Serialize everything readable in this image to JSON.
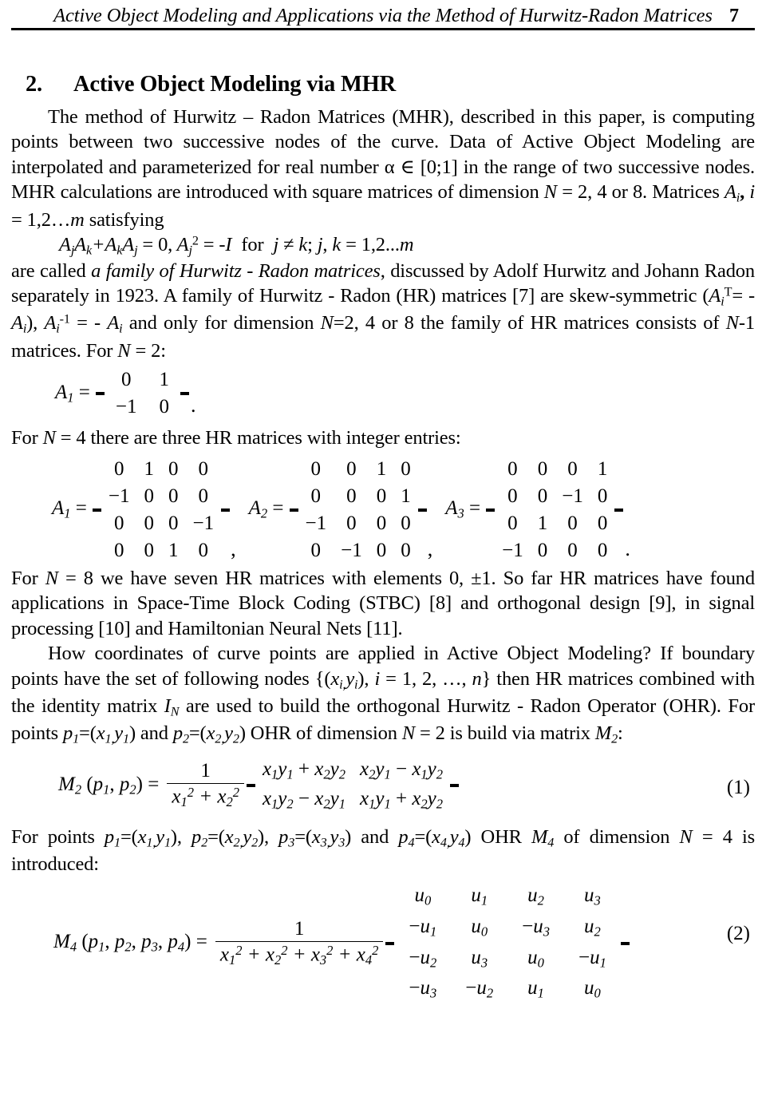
{
  "header": {
    "title": "Active Object Modeling and Applications via the Method of Hurwitz-Radon Matrices",
    "page_number": "7"
  },
  "section": {
    "number": "2.",
    "title": "Active Object Modeling via MHR"
  },
  "paragraphs": {
    "p1_a": "The method of Hurwitz – Radon Matrices (MHR), described in this paper, is computing points between two successive nodes of the curve. Data of Active Object Modeling are interpolated and parameterized for real number α ∈ [0;1] in the range of two successive nodes. MHR calculations are introduced with square matrices of dimension ",
    "p1_N": "N",
    "p1_b": " = 2, 4 or 8. Matrices ",
    "p1_Ai": "A",
    "p1_i": "i",
    "p1_c": ", ",
    "p1_i2": "i",
    "p1_d": " = 1,2…",
    "p1_m": "m",
    "p1_e": " satisfying",
    "cond_line": "AjAk+AkAj = 0, Aj2 = -I  for  j ≠ k; j, k = 1,2...m",
    "p2_a": "are called ",
    "p2_em": "a family of Hurwitz - Radon matrices",
    "p2_b": ", discussed by Adolf Hurwitz and Johann Radon separately in 1923. A family of Hurwitz - Radon (HR) matrices [7] are skew-symmetric (",
    "p2_c": "), ",
    "p2_d": " and only for dimension ",
    "p2_e": "=2, 4 or 8 the family of HR matrices consists of ",
    "p2_f": "-1 matrices. For ",
    "p2_g": " = 2:",
    "for_n4": "For N = 4 there are three HR matrices with integer entries:",
    "p3": "For N = 8 we have seven HR matrices with elements 0, ±1. So far HR matrices have found applications in Space-Time Block Coding (STBC) [8] and orthogonal design [9], in signal processing [10] and Hamiltonian Neural Nets [11].",
    "p4_a": "How coordinates of curve points are applied in Active Object Modeling? If boundary points have the set of following nodes {(",
    "p4_b": "), i = 1, 2, …, n} then HR matrices combined with the identity matrix ",
    "p4_c": " are used to build the orthogonal Hurwitz - Radon Operator (OHR). For points ",
    "p4_d": " and ",
    "p4_e": " OHR of dimension N = 2 is build via matrix ",
    "p4_f": ":",
    "p5": "For points p1=(x1,y1), p2=(x2,y2), p3=(x3,y3) and p4=(x4,y4) OHR M4 of dimension N = 4 is introduced:"
  },
  "matrices": {
    "a1_n2": {
      "label": "A",
      "label_sub": "1",
      "eq": "=",
      "rows": [
        [
          "0",
          "1"
        ],
        [
          "−1",
          "0"
        ]
      ],
      "trailing": "."
    },
    "a1_n4": {
      "label": "A",
      "label_sub": "1",
      "eq": "=",
      "rows": [
        [
          "0",
          "1",
          "0",
          "0"
        ],
        [
          "−1",
          "0",
          "0",
          "0"
        ],
        [
          "0",
          "0",
          "0",
          "−1"
        ],
        [
          "0",
          "0",
          "1",
          "0"
        ]
      ],
      "trailing": ","
    },
    "a2_n4": {
      "label": "A",
      "label_sub": "2",
      "eq": "=",
      "rows": [
        [
          "0",
          "0",
          "1",
          "0"
        ],
        [
          "0",
          "0",
          "0",
          "1"
        ],
        [
          "−1",
          "0",
          "0",
          "0"
        ],
        [
          "0",
          "−1",
          "0",
          "0"
        ]
      ],
      "trailing": ","
    },
    "a3_n4": {
      "label": "A",
      "label_sub": "3",
      "eq": "=",
      "rows": [
        [
          "0",
          "0",
          "0",
          "1"
        ],
        [
          "0",
          "0",
          "−1",
          "0"
        ],
        [
          "0",
          "1",
          "0",
          "0"
        ],
        [
          "−1",
          "0",
          "0",
          "0"
        ]
      ],
      "trailing": "."
    }
  },
  "equations": {
    "eq1": {
      "number": "(1)",
      "lhs": "M",
      "lhs_sub": "2",
      "lhs_args": "( p",
      "numerator": "1",
      "denominator": "x1 2 + x2 2",
      "rows": [
        [
          "x1y1 + x2y2",
          "x2y1 − x1y2"
        ],
        [
          "x1y2 − x2y1",
          "x1y1 + x2y2"
        ]
      ]
    },
    "eq2": {
      "number": "(2)",
      "lhs": "M",
      "lhs_sub": "4",
      "numerator": "1",
      "denominator": "x1 2 + x2 2 + x3 2 + x4 2",
      "rows": [
        [
          "u0",
          "u1",
          "u2",
          "u3"
        ],
        [
          "−u1",
          "u0",
          "−u3",
          "u2"
        ],
        [
          "−u2",
          "u3",
          "u0",
          "−u1"
        ],
        [
          "−u3",
          "−u2",
          "u1",
          "u0"
        ]
      ]
    }
  }
}
